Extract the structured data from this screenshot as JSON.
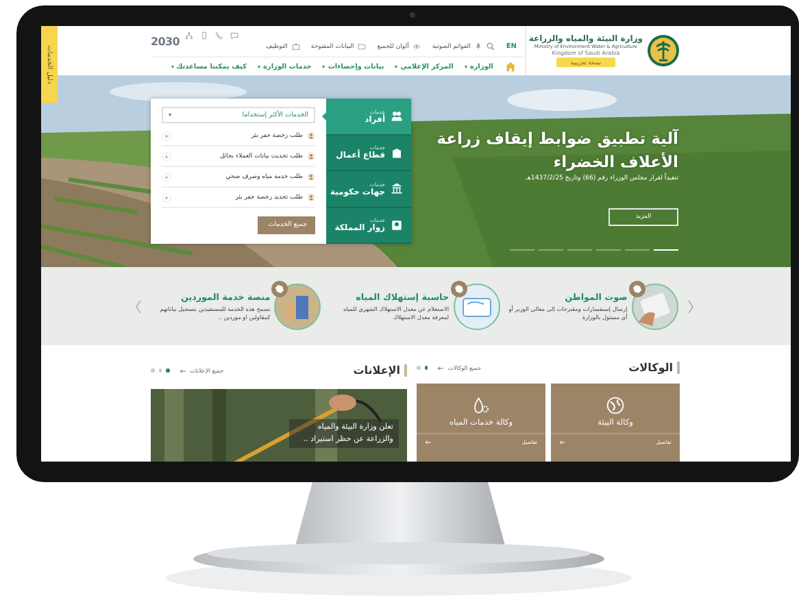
{
  "side_tab": {
    "label": "دليل الخدمات"
  },
  "header": {
    "vision_logo": "2030",
    "language": "EN",
    "utility_links": [
      {
        "label": "القوائم الصوتية"
      },
      {
        "label": "ألوان للجميع"
      },
      {
        "label": "البيانات المفتوحة"
      },
      {
        "label": "التوظيف"
      }
    ],
    "ministry": {
      "name_ar": "وزارة البيئة والمياه والزراعة",
      "name_en": "Ministry of Environment Water & Agriculture",
      "kingdom": "Kingdom of Saudi Arabia",
      "badge": "نسخة تجريبية"
    }
  },
  "nav": [
    {
      "label": "الوزارة"
    },
    {
      "label": "المركز الإعلامي"
    },
    {
      "label": "بيانات وإحصاءات"
    },
    {
      "label": "خدمات الوزارة"
    },
    {
      "label": "كيف يمكننا مساعدتك"
    }
  ],
  "services_panel": {
    "tabs": [
      {
        "caption": "خدمات",
        "label": "أفراد",
        "selected": true
      },
      {
        "caption": "خدمات",
        "label": "قطاع أعمال",
        "selected": false
      },
      {
        "caption": "خدمات",
        "label": "جهات حكومية",
        "selected": false
      },
      {
        "caption": "خدمات",
        "label": "زوار المملكة",
        "selected": false
      }
    ],
    "dropdown": "الخدمات الأكثر إستخداما",
    "items": [
      "طلب رخصة حفر بئر",
      "طلب تحديث بيانات العملاء بحائل",
      "طلب خدمة مياه وصرف صحي",
      "طلب تجديد رخصة حفر بئر"
    ],
    "button": "جميع الخدمات"
  },
  "hero": {
    "title": "آلية تطبيق ضوابط إيقاف زراعة الأعلاف الخضراء",
    "subtitle": "تنفيذاً لقرار مجلس الوزراء رقم (66) وتاريخ 1437/2/25هـ",
    "button": "المزيد",
    "slides": [
      {
        "selected": true
      },
      {
        "selected": false
      },
      {
        "selected": false
      },
      {
        "selected": false
      },
      {
        "selected": false
      },
      {
        "selected": false
      }
    ]
  },
  "featured": [
    {
      "title": "صوت المواطن",
      "description": "إرسال إستفسارات ومقترحات إلى معالي الوزير أو أي مسئول بالوزارة"
    },
    {
      "title": "حاسبة إستهلاك المياه",
      "description": "الاستعلام عن معدل الاستهلاك الشهري للمياه لمعرفة معدل الاستهلاك"
    },
    {
      "title": "منصة خدمة الموردين",
      "description": "تسمح هذه الخدمة للمستفيدين بتسجيل بياناتهم كمقاولين او موردين .."
    }
  ],
  "agencies": {
    "title": "الوكالات",
    "all_link": "جميع الوكالات",
    "pages": [
      {
        "selected": true
      },
      {
        "selected": false
      }
    ],
    "items": [
      {
        "title": "وكالة البيئة",
        "link": "تفاصيل"
      },
      {
        "title": "وكالة خدمات المياه",
        "link": "تفاصيل"
      }
    ]
  },
  "announcements": {
    "title": "الإعلانات",
    "all_link": "جميع الإعلانات",
    "pages": [
      {
        "selected": true
      },
      {
        "selected": false
      },
      {
        "selected": false
      }
    ],
    "items": [
      {
        "title": "تعلن وزارة البيئة والمياه والزراعة عن حظر استيراد .."
      }
    ]
  }
}
